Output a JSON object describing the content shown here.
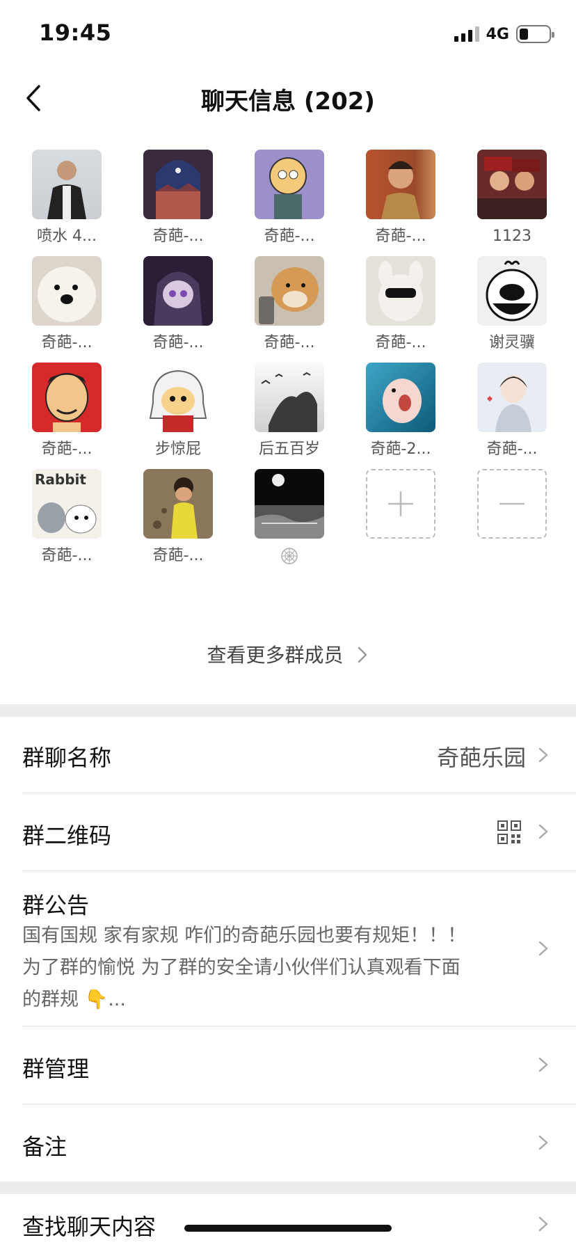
{
  "status": {
    "time": "19:45",
    "network": "4G"
  },
  "header": {
    "title": "聊天信息 (202)"
  },
  "members": [
    {
      "name": "喷水 4..."
    },
    {
      "name": "奇葩-..."
    },
    {
      "name": "奇葩-..."
    },
    {
      "name": "奇葩-..."
    },
    {
      "name": "1123"
    },
    {
      "name": "奇葩-..."
    },
    {
      "name": "奇葩-..."
    },
    {
      "name": "奇葩-..."
    },
    {
      "name": "奇葩-..."
    },
    {
      "name": "谢灵骥"
    },
    {
      "name": "奇葩-..."
    },
    {
      "name": "步惊屁"
    },
    {
      "name": "后五百岁"
    },
    {
      "name": "奇葩-2..."
    },
    {
      "name": "奇葩-..."
    },
    {
      "name": "奇葩-..."
    },
    {
      "name": "奇葩-..."
    },
    {
      "name": ""
    }
  ],
  "view_more": "查看更多群成员",
  "settings": {
    "group_name_label": "群聊名称",
    "group_name_value": "奇葩乐园",
    "qr_label": "群二维码",
    "notice_label": "群公告",
    "notice_text_1": "国有国规 家有家规 咋们的奇葩乐园也要有规矩！！！",
    "notice_text_2": "为了群的愉悦 为了群的安全请小伙伴们认真观看下面",
    "notice_text_3": "的群规 👇...",
    "manage_label": "群管理",
    "remark_label": "备注",
    "search_label": "查找聊天内容"
  }
}
